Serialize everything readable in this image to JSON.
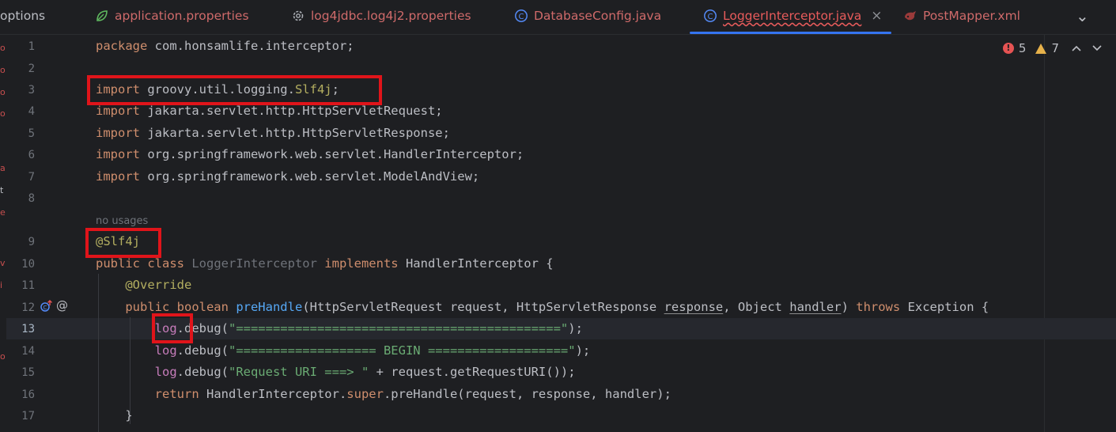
{
  "tabs": [
    {
      "label": "options",
      "icon": "none"
    },
    {
      "label": "application.properties",
      "icon": "spring-leaf-icon"
    },
    {
      "label": "log4jdbc.log4j2.properties",
      "icon": "gear-icon"
    },
    {
      "label": "DatabaseConfig.java",
      "icon": "java-class-icon"
    },
    {
      "label": "LoggerInterceptor.java",
      "icon": "java-class-icon",
      "active": true
    },
    {
      "label": "PostMapper.xml",
      "icon": "mybatis-icon"
    }
  ],
  "close_glyph": "×",
  "menu_glyph": "⌄",
  "inspections": {
    "errors": "5",
    "warnings": "7"
  },
  "gutter": [
    "1",
    "2",
    "3",
    "4",
    "5",
    "6",
    "7",
    "8",
    "9",
    "10",
    "11",
    "12",
    "13",
    "14",
    "15",
    "16",
    "17"
  ],
  "hint": "no usages",
  "code": {
    "l1_kw": "package",
    "l1_rest": " com.honsamlife.interceptor;",
    "l3_kw": "import",
    "l3_rest": " groovy.util.logging.",
    "l3_ann": "Slf4j",
    "l3_end": ";",
    "l4_kw": "import",
    "l4_rest": " jakarta.servlet.http.HttpServletRequest;",
    "l5_kw": "import",
    "l5_rest": " jakarta.servlet.http.HttpServletResponse;",
    "l6_kw": "import",
    "l6_rest": " org.springframework.web.servlet.HandlerInterceptor;",
    "l7_kw": "import",
    "l7_rest": " org.springframework.web.servlet.ModelAndView;",
    "l9_ann": "@Slf4j",
    "l10_kw1": "public class ",
    "l10_name": "LoggerInterceptor",
    "l10_kw2": " implements ",
    "l10_rest": "HandlerInterceptor {",
    "l11_ann": "@Override",
    "l12_kw": "public boolean ",
    "l12_fn": "preHandle",
    "l12_a": "(HttpServletRequest request, HttpServletResponse ",
    "l12_p1": "response",
    "l12_b": ", Object ",
    "l12_p2": "handler",
    "l12_c": ") ",
    "l12_kw2": "throws",
    "l12_d": " Exception {",
    "l13_log": "log",
    "l13_a": ".debug(",
    "l13_str": "\"============================================\"",
    "l13_b": ");",
    "l14_log": "log",
    "l14_a": ".debug(",
    "l14_str": "\"=================== BEGIN ===================\"",
    "l14_b": ");",
    "l15_log": "log",
    "l15_a": ".debug(",
    "l15_str": "\"Request URI ===> \"",
    "l15_b": " + request.getRequestURI());",
    "l16_kw": "return",
    "l16_a": " HandlerInterceptor.",
    "l16_kw2": "super",
    "l16_b": ".preHandle(request, response, handler);",
    "l17": "}"
  },
  "colors": {
    "highlight": "#e0141a",
    "accent": "#3574f0"
  }
}
